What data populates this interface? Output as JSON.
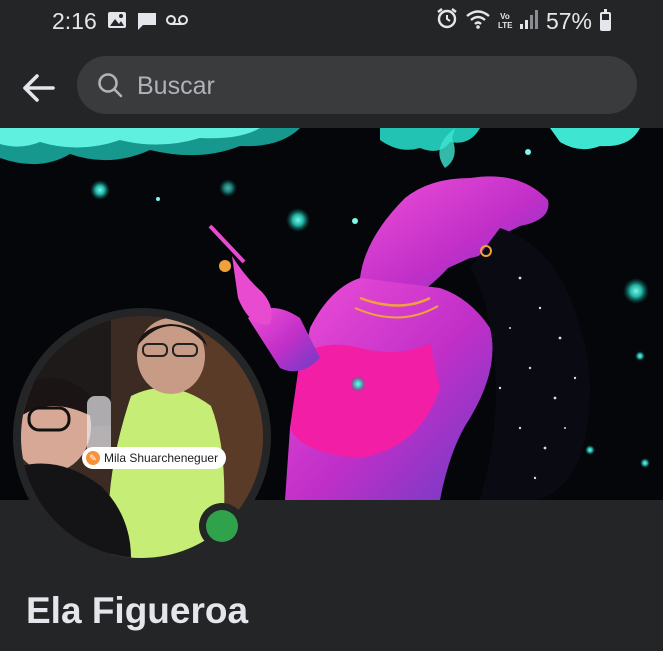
{
  "status_bar": {
    "time": "2:16",
    "network_label": "Vo LTE",
    "battery_text": "57%",
    "battery_level": 0.57,
    "icons": [
      "image-icon",
      "chat-bubble-icon",
      "voicemail-icon",
      "alarm-icon",
      "wifi-icon",
      "signal-icon",
      "battery-icon"
    ]
  },
  "search": {
    "placeholder": "Buscar",
    "value": ""
  },
  "profile": {
    "name": "Ela Figueroa",
    "photo_tag": "Mila Shuarcheneguer",
    "online": true
  },
  "colors": {
    "background": "#242526",
    "search_field": "#3a3b3c",
    "text_primary": "#e4e6eb",
    "text_secondary": "#b0b3b8",
    "online_indicator": "#31a24c",
    "cover_teal": "#3ee6d2",
    "cover_magenta": "#e62ec4"
  }
}
